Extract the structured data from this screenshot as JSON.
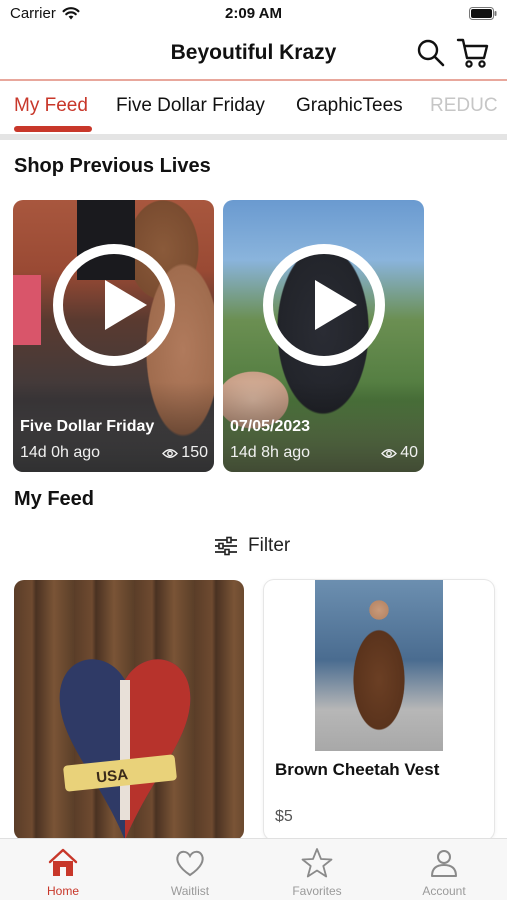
{
  "status_bar": {
    "carrier": "Carrier",
    "time": "2:09 AM"
  },
  "header": {
    "title": "Beyoutiful Krazy"
  },
  "tabs": [
    {
      "label": "My Feed",
      "active": true
    },
    {
      "label": "Five Dollar Friday",
      "active": false
    },
    {
      "label": "GraphicTees",
      "active": false
    },
    {
      "label": "REDUC",
      "active": false
    }
  ],
  "previous_lives": {
    "title": "Shop Previous Lives",
    "items": [
      {
        "name": "Five Dollar Friday",
        "ago": "14d 0h ago",
        "views": "150"
      },
      {
        "name": "07/05/2023",
        "ago": "14d 8h ago",
        "views": "40"
      }
    ]
  },
  "feed": {
    "title": "My Feed",
    "filter_label": "Filter",
    "products": [
      {
        "name": "",
        "price": ""
      },
      {
        "name": "Brown Cheetah Vest",
        "price": "$5"
      }
    ]
  },
  "bottom_nav": [
    {
      "label": "Home",
      "icon": "home-icon",
      "active": true
    },
    {
      "label": "Waitlist",
      "icon": "heart-icon",
      "active": false
    },
    {
      "label": "Favorites",
      "icon": "star-icon",
      "active": false
    },
    {
      "label": "Account",
      "icon": "person-icon",
      "active": false
    }
  ],
  "colors": {
    "accent": "#c8372a",
    "inactive": "#9a9a9a",
    "divider": "#e4e4e4"
  }
}
